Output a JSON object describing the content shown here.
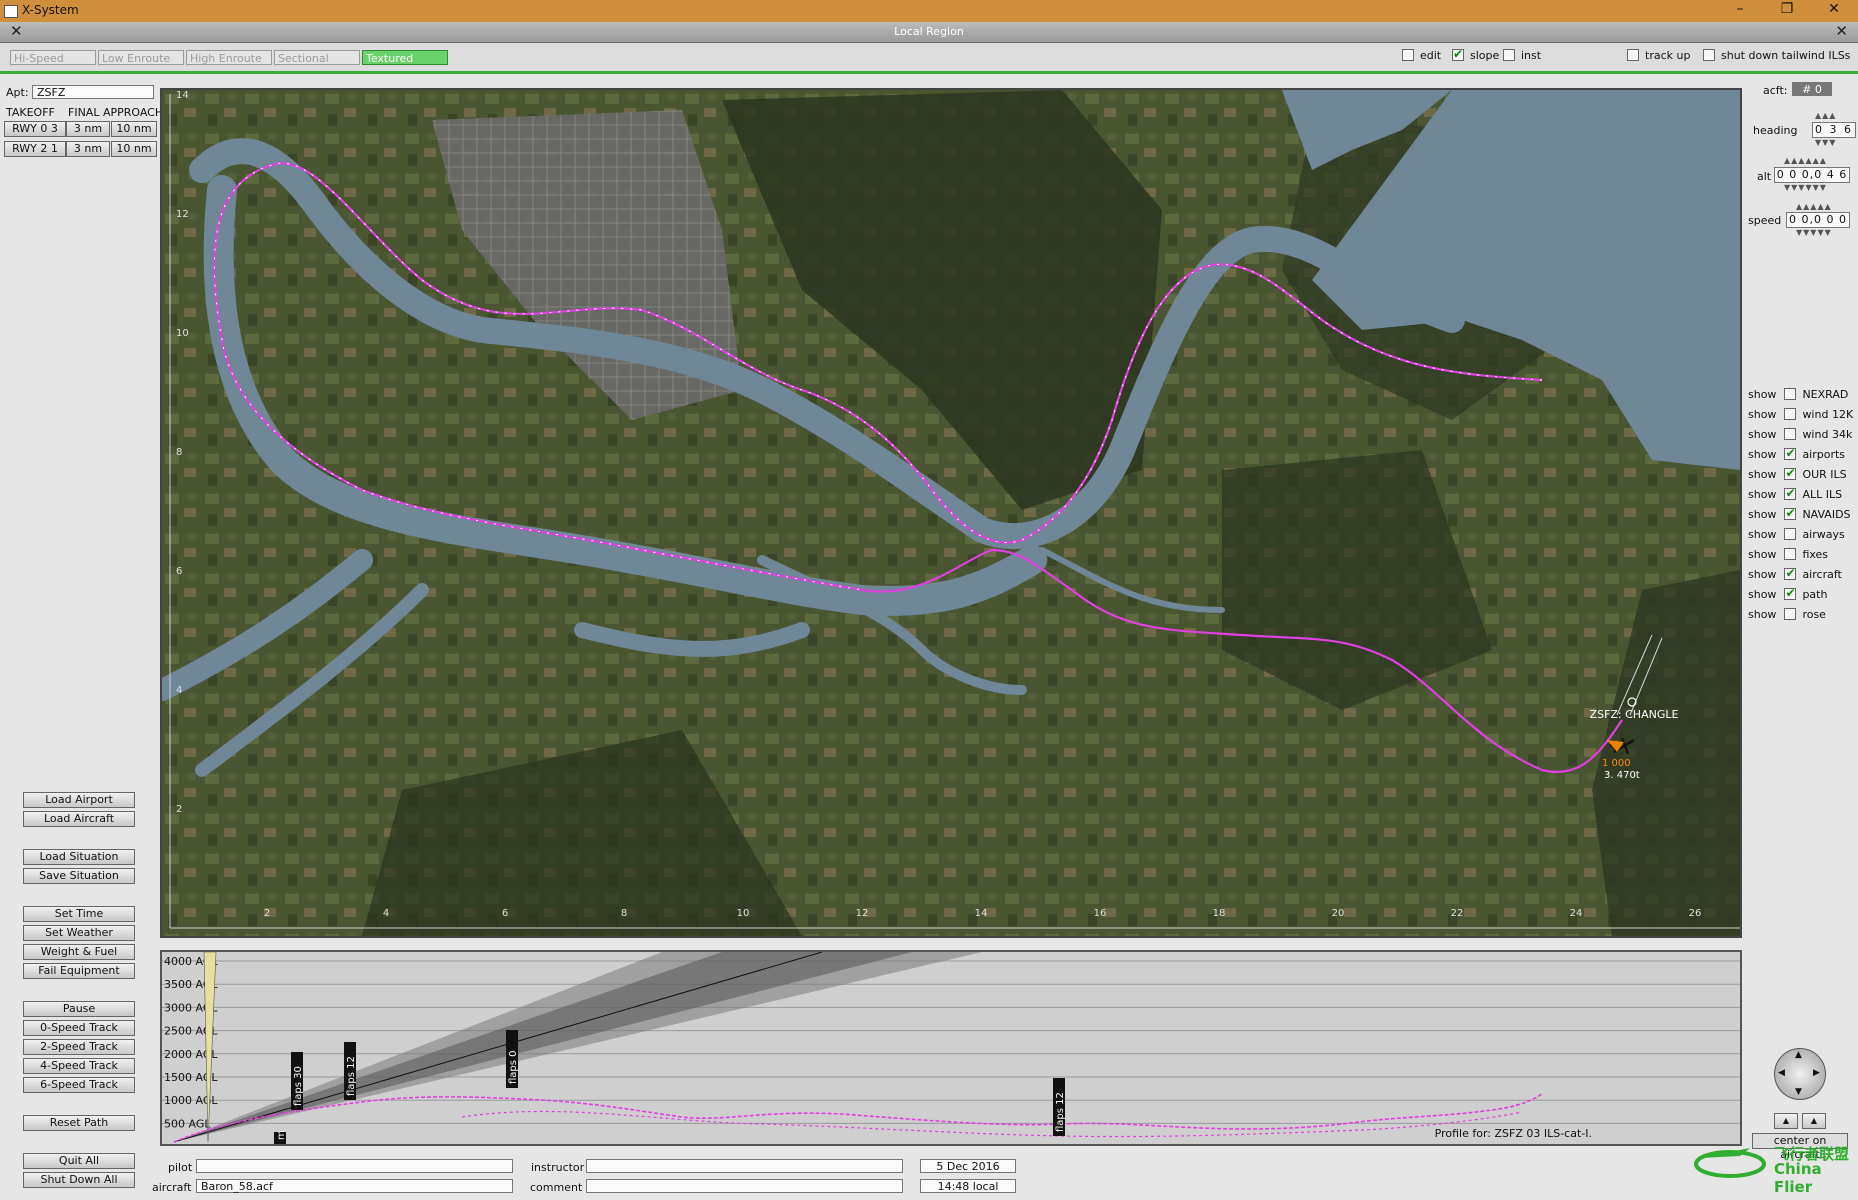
{
  "window": {
    "title": "X-System",
    "minimize": "–",
    "restore": "❐",
    "close": "✕"
  },
  "subwindow": {
    "title": "Local Region",
    "close_left": "✕",
    "close_right": "✕"
  },
  "tabs": [
    {
      "label": "Hi-Speed"
    },
    {
      "label": "Low Enroute"
    },
    {
      "label": "High Enroute"
    },
    {
      "label": "Sectional"
    },
    {
      "label": "Textured",
      "active": true
    }
  ],
  "toggles": {
    "edit": {
      "label": "edit",
      "checked": false
    },
    "slope": {
      "label": "slope",
      "checked": true
    },
    "inst": {
      "label": "inst",
      "checked": false
    },
    "track_up": {
      "label": "track up",
      "checked": false
    },
    "shutdown": {
      "label": "shut down tailwind ILSs",
      "checked": false
    }
  },
  "left": {
    "apt_label": "Apt:",
    "apt_value": "ZSFZ",
    "takeoff": "TAKEOFF",
    "final_approach": "FINAL APPROACH",
    "runways": [
      {
        "rwy": "RWY 0 3",
        "d1": "3 nm",
        "d2": "10 nm"
      },
      {
        "rwy": "RWY 2 1",
        "d1": "3 nm",
        "d2": "10 nm"
      }
    ],
    "buttons": {
      "load_airport": "Load Airport",
      "load_aircraft": "Load Aircraft",
      "load_situation": "Load Situation",
      "save_situation": "Save Situation",
      "set_time": "Set Time",
      "set_weather": "Set Weather",
      "weight_fuel": "Weight & Fuel",
      "fail_equipment": "Fail Equipment",
      "pause": "Pause",
      "speed0": "0-Speed Track",
      "speed2": "2-Speed Track",
      "speed4": "4-Speed Track",
      "speed6": "6-Speed Track",
      "reset_path": "Reset Path",
      "quit_all": "Quit All",
      "shut_down_all": "Shut Down All"
    }
  },
  "right": {
    "acft_label": "acft:",
    "acft_value": "# 0",
    "heading_label": "heading",
    "heading_value": "0 3 6",
    "alt_label": "alt",
    "alt_value": "0 0 0,0 4 6",
    "speed_label": "speed",
    "speed_value": "0 0,0 0 0",
    "show_label": "show",
    "layers": [
      {
        "name": "NEXRAD",
        "on": false
      },
      {
        "name": "wind 12K",
        "on": false
      },
      {
        "name": "wind 34k",
        "on": false
      },
      {
        "name": "airports",
        "on": true
      },
      {
        "name": "OUR ILS",
        "on": true
      },
      {
        "name": "ALL ILS",
        "on": true
      },
      {
        "name": "NAVAIDS",
        "on": true
      },
      {
        "name": "airways",
        "on": false
      },
      {
        "name": "fixes",
        "on": false
      },
      {
        "name": "aircraft",
        "on": true
      },
      {
        "name": "path",
        "on": true
      },
      {
        "name": "rose",
        "on": false
      }
    ],
    "center_on_aircraft": "center on aircraft"
  },
  "map": {
    "x_ticks": [
      "2",
      "4",
      "6",
      "8",
      "10",
      "12",
      "14",
      "16",
      "18",
      "20",
      "22",
      "24",
      "26"
    ],
    "y_ticks": [
      "14",
      "12",
      "10",
      "8",
      "6",
      "4",
      "2"
    ],
    "airport_label": "ZSFZ: CHANGLE",
    "aircraft_tag1": "1 000",
    "aircraft_tag2": "3. 470t",
    "colors": {
      "water": "#6f8796",
      "land": "#3e4a2c",
      "path": "#e040e0",
      "city": "#6d6d6d"
    }
  },
  "profile": {
    "agl_labels": [
      "4000 AGL",
      "3500 AGL",
      "3000 AGL",
      "2500 AGL",
      "2000 AGL",
      "1500 AGL",
      "1000 AGL",
      "500 AGL"
    ],
    "flags": [
      {
        "text": "flaps 30"
      },
      {
        "text": "flaps 12"
      },
      {
        "text": "flaps 0"
      },
      {
        "text": "flaps 12"
      },
      {
        "text": "m"
      }
    ],
    "caption": "Profile for: ZSFZ 03  ILS-cat-I."
  },
  "bottom": {
    "pilot_label": "pilot",
    "pilot_value": "",
    "instructor_label": "instructor",
    "instructor_value": "",
    "aircraft_label": "aircraft",
    "aircraft_value": "Baron_58.acf",
    "comment_label": "comment",
    "comment_value": "",
    "date": "5 Dec  2016",
    "time": "14:48 local"
  },
  "watermark": {
    "cn": "飞行者联盟",
    "en": "China Flier"
  }
}
